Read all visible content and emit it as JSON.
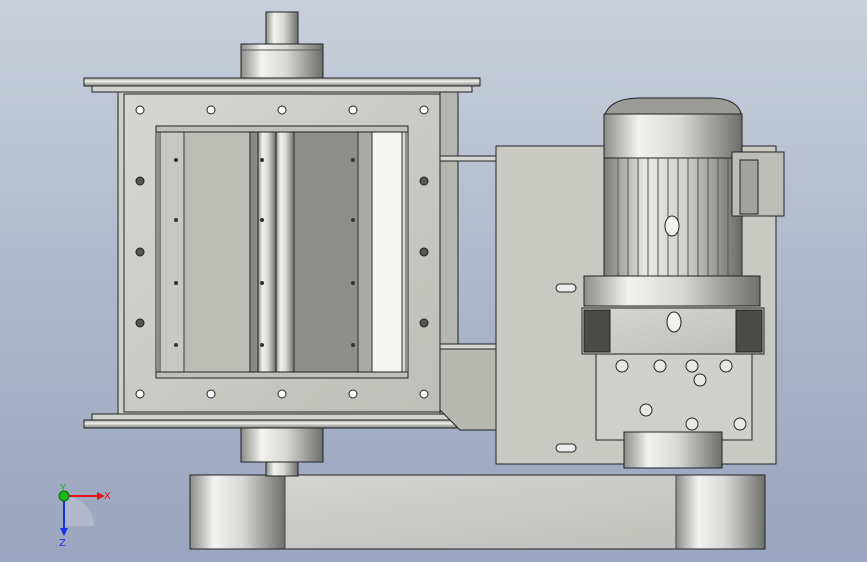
{
  "viewport": {
    "background_top": "#c9cfdc",
    "background_bottom": "#9aa6bf"
  },
  "model": {
    "part": "rotary-valve-assembly",
    "view": "front"
  },
  "triad": {
    "x_label": "X",
    "y_label": "Y",
    "z_label": "Z",
    "x_color": "#e01818",
    "y_color": "#18b818",
    "z_color": "#1830e0"
  },
  "colors": {
    "steel_light": "#e8e8e8",
    "steel_mid": "#c4c4c0",
    "steel_dark": "#8a8a86",
    "outline": "#222222"
  }
}
